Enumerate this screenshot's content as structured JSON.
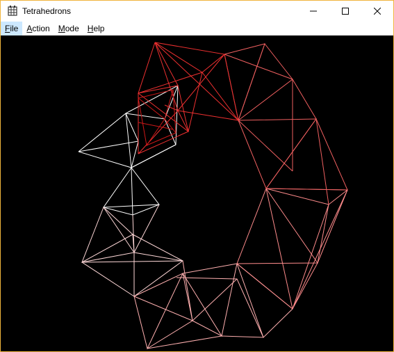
{
  "window": {
    "title": "Tetrahedrons",
    "app_icon": "grid-app-icon",
    "buttons": [
      "minimize-icon",
      "maximize-icon",
      "close-icon"
    ]
  },
  "menu": {
    "items": [
      {
        "first": "F",
        "rest": "ile"
      },
      {
        "first": "A",
        "rest": "ction"
      },
      {
        "first": "M",
        "rest": "ode"
      },
      {
        "first": "H",
        "rest": "elp"
      }
    ]
  },
  "scene": {
    "background": "#000000",
    "colors": {
      "white": "#ffffff",
      "pink": "#ffb8b8",
      "salmon": "#ff8080",
      "red": "#ee2a2a",
      "crimson": "#dd2020"
    }
  }
}
